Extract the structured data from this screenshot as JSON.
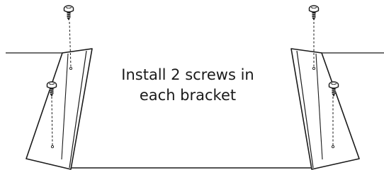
{
  "instruction": {
    "line1": "Install 2 screws in",
    "line2": "each bracket"
  },
  "colors": {
    "ink": "#1a1a1a",
    "background": "#ffffff"
  },
  "icons": [
    "screw-icon",
    "screw-hole-icon",
    "bracket",
    "cabinet-edge"
  ]
}
